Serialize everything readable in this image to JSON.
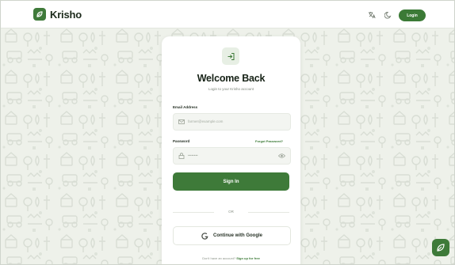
{
  "header": {
    "brand_name": "Krisho",
    "login_label": "Login",
    "icons": [
      "language-icon",
      "theme-toggle-icon"
    ]
  },
  "card": {
    "title": "Welcome Back",
    "subtitle": "Login to your Krisho account",
    "email_label": "Email Address",
    "email_placeholder": "farmer@example.com",
    "password_label": "Password",
    "forgot_label": "Forgot Password?",
    "password_placeholder": "••••••••",
    "signin_label": "Sign In",
    "or_label": "OR",
    "google_label": "Continue with Google",
    "no_account_text": "Don't have an account?",
    "signup_label": "Sign up for free"
  },
  "colors": {
    "brand_green": "#3e7a39",
    "page_bg": "#eef1ea",
    "card_bg": "#ffffff"
  }
}
